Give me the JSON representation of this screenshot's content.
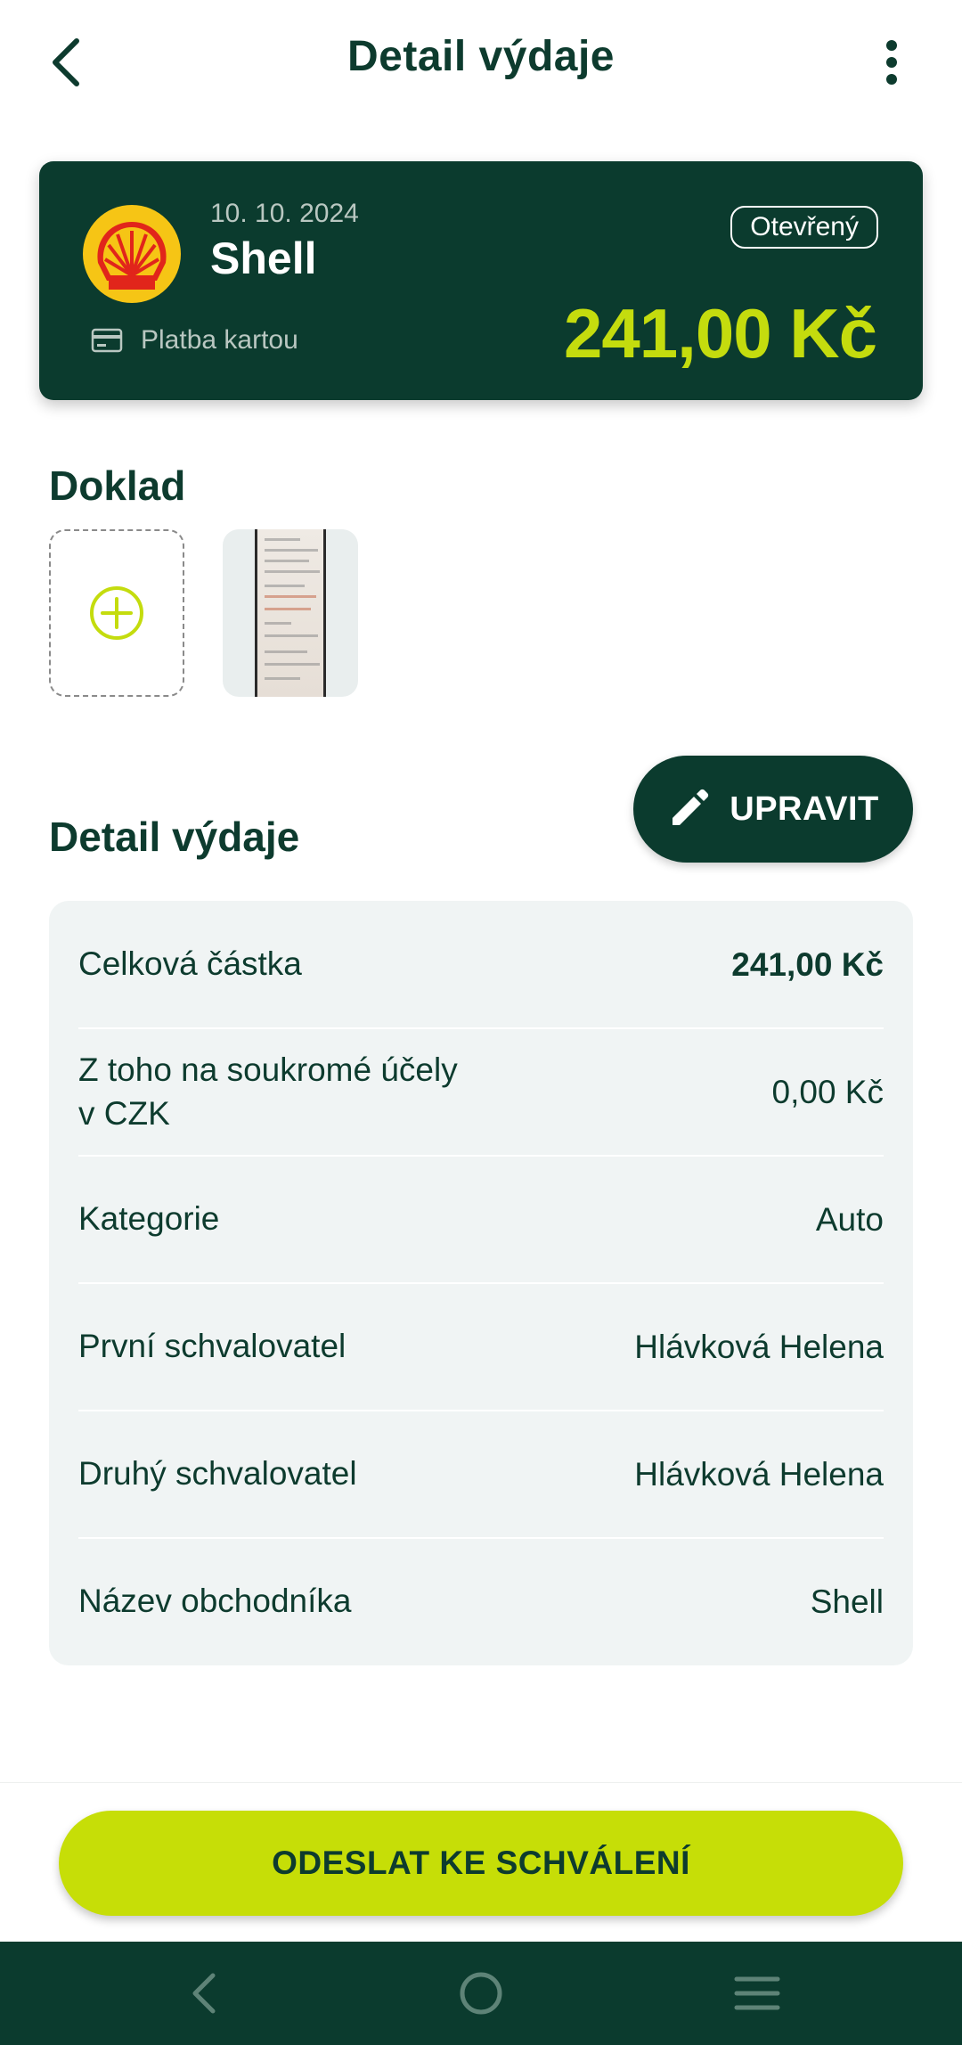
{
  "header": {
    "title": "Detail výdaje",
    "back_icon": "chevron-left-icon",
    "more_icon": "more-vertical-icon"
  },
  "summary": {
    "date": "10. 10. 2024",
    "merchant": "Shell",
    "status": "Otevřený",
    "payment_method": "Platba kartou",
    "amount": "241,00 Kč",
    "colors": {
      "card_bg": "#0b3b2e",
      "accent": "#c4dc0e"
    }
  },
  "documents": {
    "heading": "Doklad",
    "add_icon": "plus-circle-icon"
  },
  "detail": {
    "heading": "Detail výdaje",
    "edit_label": "UPRAVIT",
    "rows": [
      {
        "label": "Celková částka",
        "value": "241,00 Kč"
      },
      {
        "label": "Z toho na soukromé účely v CZK",
        "value": "0,00 Kč"
      },
      {
        "label": "Kategorie",
        "value": "Auto"
      },
      {
        "label": "První schvalovatel",
        "value": "Hlávková Helena"
      },
      {
        "label": "Druhý schvalovatel",
        "value": "Hlávková Helena"
      },
      {
        "label": "Název obchodníka",
        "value": "Shell"
      }
    ]
  },
  "actions": {
    "submit_label": "ODESLAT KE SCHVÁLENÍ"
  },
  "system_nav": {
    "back_icon": "nav-back-icon",
    "home_icon": "nav-home-icon",
    "recents_icon": "nav-recents-icon"
  }
}
